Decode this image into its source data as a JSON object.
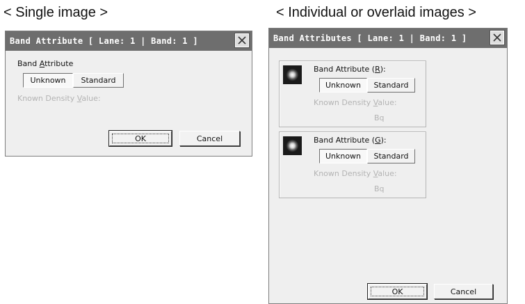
{
  "headings": {
    "single": "< Single image >",
    "multi": "< Individual or overlaid images >"
  },
  "single_dialog": {
    "title": "Band Attribute [ Lane: 1 | Band: 1 ]",
    "attribute_label_pre": "Band ",
    "attribute_label_key": "A",
    "attribute_label_post": "ttribute",
    "toggle": [
      "Unknown",
      "Standard"
    ],
    "selected": "Unknown",
    "density_label_pre": "Known Density ",
    "density_label_key": "V",
    "density_label_post": "alue:",
    "ok_label": "OK",
    "cancel_label": "Cancel"
  },
  "multi_dialog": {
    "title": "Band Attributes [ Lane: 1 | Band: 1 ]",
    "groups": [
      {
        "label_pre": "Band Attribute (",
        "label_key": "R",
        "label_post": "):",
        "toggle": [
          "Unknown",
          "Standard"
        ],
        "selected": "Unknown",
        "density_label_pre": "Known Density ",
        "density_label_key": "V",
        "density_label_post": "alue:",
        "unit": "Bq"
      },
      {
        "label_pre": "Band Attribute (",
        "label_key": "G",
        "label_post": "):",
        "toggle": [
          "Unknown",
          "Standard"
        ],
        "selected": "Unknown",
        "density_label_pre": "Known Density ",
        "density_label_key": "V",
        "density_label_post": "alue:",
        "unit": "Bq"
      }
    ],
    "ok_label": "OK",
    "cancel_label": "Cancel"
  },
  "icons": {
    "close": "close-icon",
    "band_preview": "band-preview-icon"
  },
  "colors": {
    "titlebar": "#6e6e6e",
    "dialog_bg": "#efefef",
    "disabled_text": "#b3b3b3"
  }
}
